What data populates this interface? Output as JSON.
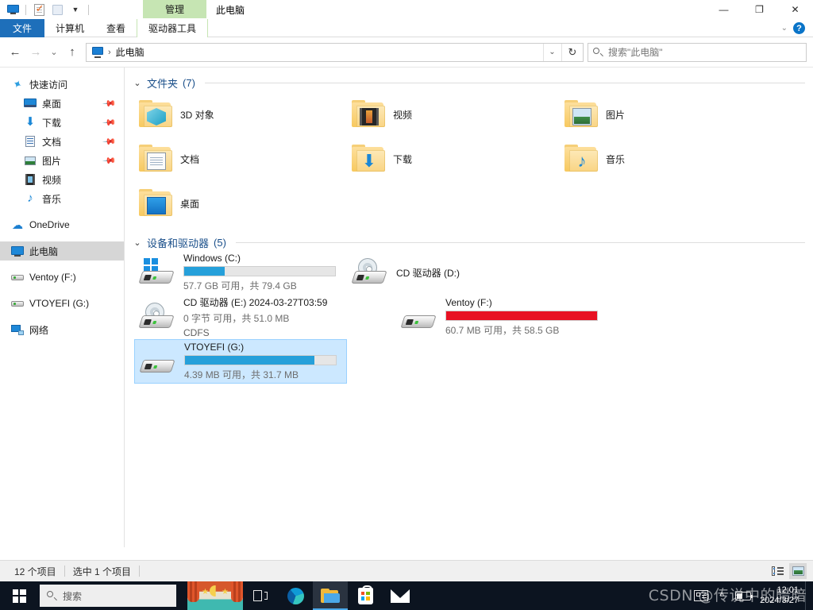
{
  "window": {
    "title": "此电脑",
    "contextual_tab": "管理",
    "quick_access": [
      "pc-icon",
      "properties-icon",
      "new-folder-icon",
      "customize-dropdown-icon"
    ],
    "controls": {
      "minimize": "—",
      "restore": "❐",
      "close": "✕",
      "collapse_ribbon": "⌄",
      "help": "?"
    }
  },
  "ribbon": {
    "tabs": [
      {
        "label": "文件",
        "active": true
      },
      {
        "label": "计算机",
        "active": false
      },
      {
        "label": "查看",
        "active": false
      },
      {
        "label": "驱动器工具",
        "active": false,
        "contextual": true
      }
    ]
  },
  "address": {
    "back": "←",
    "forward": "→",
    "recent": "⌄",
    "up": "↑",
    "crumb_icon": "pc-icon",
    "crumb_sep": "›",
    "path": "此电脑",
    "dropdown": "⌄",
    "refresh": "↻"
  },
  "search": {
    "placeholder": "搜索\"此电脑\"",
    "value": "",
    "icon": "search-icon"
  },
  "sidebar": {
    "items": [
      {
        "label": "快速访问",
        "icon": "star-icon",
        "level": 1,
        "pinned": false,
        "selected": false
      },
      {
        "label": "桌面",
        "icon": "desktop-icon",
        "level": 2,
        "pinned": true,
        "selected": false
      },
      {
        "label": "下载",
        "icon": "download-icon",
        "level": 2,
        "pinned": true,
        "selected": false
      },
      {
        "label": "文档",
        "icon": "documents-icon",
        "level": 2,
        "pinned": true,
        "selected": false
      },
      {
        "label": "图片",
        "icon": "pictures-icon",
        "level": 2,
        "pinned": true,
        "selected": false
      },
      {
        "label": "视频",
        "icon": "videos-icon",
        "level": 2,
        "pinned": false,
        "selected": false
      },
      {
        "label": "音乐",
        "icon": "music-icon",
        "level": 2,
        "pinned": false,
        "selected": false
      },
      {
        "label": "OneDrive",
        "icon": "cloud-icon",
        "level": 1,
        "pinned": false,
        "selected": false
      },
      {
        "label": "此电脑",
        "icon": "pc-icon",
        "level": 1,
        "pinned": false,
        "selected": true
      },
      {
        "label": "Ventoy (F:)",
        "icon": "drive-icon",
        "level": 1,
        "pinned": false,
        "selected": false
      },
      {
        "label": "VTOYEFI (G:)",
        "icon": "drive-icon",
        "level": 1,
        "pinned": false,
        "selected": false
      },
      {
        "label": "网络",
        "icon": "network-icon",
        "level": 1,
        "pinned": false,
        "selected": false
      }
    ]
  },
  "groups": {
    "folders": {
      "chevron": "⌄",
      "title": "文件夹",
      "count": "(7)",
      "items": [
        {
          "label": "3D 对象",
          "icon": "folder-3d-objects"
        },
        {
          "label": "视频",
          "icon": "folder-videos"
        },
        {
          "label": "图片",
          "icon": "folder-pictures"
        },
        {
          "label": "文档",
          "icon": "folder-documents"
        },
        {
          "label": "下载",
          "icon": "folder-downloads"
        },
        {
          "label": "音乐",
          "icon": "folder-music"
        },
        {
          "label": "桌面",
          "icon": "folder-desktop"
        }
      ]
    },
    "drives": {
      "chevron": "⌄",
      "title": "设备和驱动器",
      "count": "(5)",
      "items": [
        {
          "name": "Windows (C:)",
          "icon": "hdd-windows-icon",
          "capacity_text": "57.7 GB 可用，共 79.4 GB",
          "used_percent": 27,
          "bar_color": "#26a0da",
          "has_bar": true,
          "filesystem": "",
          "selected": false
        },
        {
          "name": "CD 驱动器 (D:)",
          "icon": "cd-drive-icon",
          "capacity_text": "",
          "used_percent": 0,
          "bar_color": "",
          "has_bar": false,
          "filesystem": "",
          "selected": false
        },
        {
          "name": "CD 驱动器 (E:) 2024-03-27T03:59",
          "icon": "cd-drive-icon",
          "capacity_text": "0 字节 可用，共 51.0 MB",
          "used_percent": 100,
          "bar_color": "",
          "has_bar": false,
          "filesystem": "CDFS",
          "selected": false
        },
        {
          "name": "Ventoy (F:)",
          "icon": "hdd-icon",
          "capacity_text": "60.7 MB 可用，共 58.5 GB",
          "used_percent": 100,
          "bar_color": "#e81123",
          "has_bar": true,
          "filesystem": "",
          "selected": false
        },
        {
          "name": "VTOYEFI (G:)",
          "icon": "hdd-icon",
          "capacity_text": "4.39 MB 可用，共 31.7 MB",
          "used_percent": 86,
          "bar_color": "#26a0da",
          "has_bar": true,
          "filesystem": "",
          "selected": true
        }
      ]
    }
  },
  "statusbar": {
    "item_count": "12 个项目",
    "selection": "选中 1 个项目",
    "views": [
      {
        "name": "details-view",
        "active": false
      },
      {
        "name": "large-icons-view",
        "active": true
      }
    ]
  },
  "taskbar": {
    "start": "start-button",
    "search_placeholder": "搜索",
    "items": [
      {
        "name": "news-weather-widget",
        "active": false
      },
      {
        "name": "task-view-button",
        "active": false
      },
      {
        "name": "microsoft-edge",
        "active": false
      },
      {
        "name": "file-explorer",
        "active": true
      },
      {
        "name": "microsoft-store",
        "active": false
      },
      {
        "name": "mail",
        "active": false
      }
    ],
    "tray": {
      "news": "news-icon",
      "chevron": "^",
      "battery": "battery-icon"
    },
    "clock": {
      "time": "12:01",
      "date": "2024/3/27"
    },
    "watermark": "CSDN @传说中的暗暗"
  },
  "colors": {
    "accent": "#26a0da",
    "danger": "#e81123",
    "selection": "#cce8ff",
    "ribbon_file": "#1e6fba",
    "contextual_tab": "#c6e5b3",
    "group_title": "#1a4f8a"
  }
}
